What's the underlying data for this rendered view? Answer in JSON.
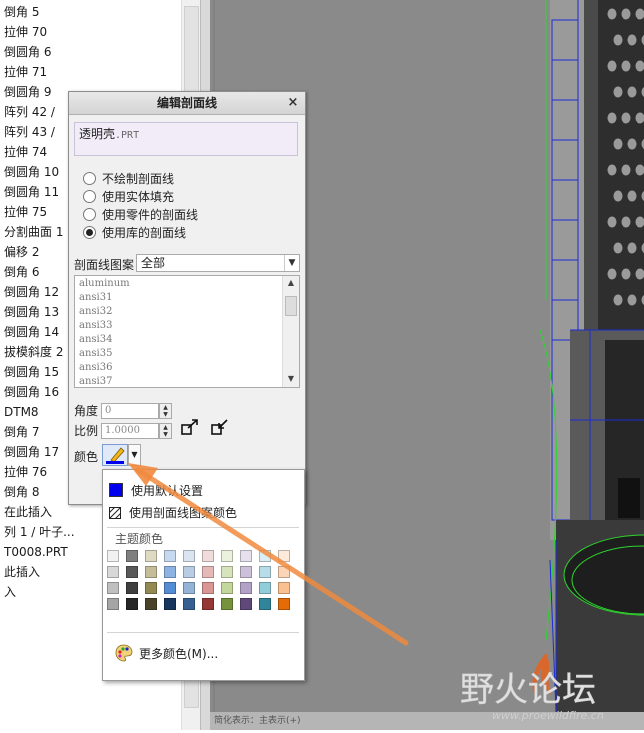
{
  "tree": {
    "items": [
      "倒角 5",
      "拉伸 70",
      "倒圆角 6",
      "拉伸 71",
      "倒圆角 9",
      "阵列 42 /",
      "阵列 43 /",
      "拉伸 74",
      "倒圆角 10",
      "倒圆角 11",
      "拉伸 75",
      "分割曲面 1",
      "偏移 2",
      "倒角 6",
      "倒圆角 12",
      "倒圆角 13",
      "倒圆角 14",
      "拔模斜度 2",
      "倒圆角 15",
      "倒圆角 16",
      "DTM8",
      "倒角 7",
      "倒圆角 17",
      "拉伸 76",
      "倒角 8",
      "在此插入",
      "列 1 / 叶子...",
      "T0008.PRT",
      "此插入",
      "入"
    ]
  },
  "dialog": {
    "title": "编辑剖面线",
    "close": "×",
    "part_name": "透明壳",
    "part_ext": ".PRT",
    "options": [
      {
        "label": "不绘制剖面线",
        "selected": false
      },
      {
        "label": "使用实体填充",
        "selected": false
      },
      {
        "label": "使用零件的剖面线",
        "selected": false
      },
      {
        "label": "使用库的剖面线",
        "selected": true
      }
    ],
    "pattern_label": "剖面线图案",
    "pattern_value": "全部",
    "pattern_list": [
      "aluminum",
      "ansi31",
      "ansi32",
      "ansi33",
      "ansi34",
      "ansi35",
      "ansi36",
      "ansi37"
    ],
    "angle_label": "角度",
    "angle_value": "0",
    "scale_label": "比例",
    "scale_value": "1.0000",
    "color_label": "颜色"
  },
  "color_menu": {
    "use_default": "使用默认设置",
    "use_pattern": "使用剖面线图案颜色",
    "theme_title": "主题颜色",
    "more": "更多颜色(M)...",
    "default_color": "#0000ee",
    "theme_rows": [
      [
        "#f2f2f2",
        "#7f7f7f",
        "#ddd9c3",
        "#c6d9f0",
        "#dbe5f1",
        "#f2dcdb",
        "#ebf1dd",
        "#e5e0ec",
        "#dbeef3",
        "#fdeada"
      ],
      [
        "#d8d8d8",
        "#595959",
        "#c4bd97",
        "#8db3e2",
        "#b8cce4",
        "#e5b9b7",
        "#d7e3bc",
        "#ccc1d9",
        "#b7dde8",
        "#fbd5b5"
      ],
      [
        "#bfbfbf",
        "#3f3f3f",
        "#938953",
        "#548dd4",
        "#95b3d7",
        "#d99694",
        "#c3d69b",
        "#b2a2c7",
        "#92cddc",
        "#fac08f"
      ],
      [
        "#a5a5a5",
        "#262626",
        "#494429",
        "#17365d",
        "#366092",
        "#953734",
        "#76923c",
        "#5f497a",
        "#31859b",
        "#e36c09"
      ]
    ]
  },
  "status": {
    "text": "简化表示：主表示(+)"
  },
  "watermark": {
    "main": "野火论坛",
    "url": "www.proewildfire.cn"
  }
}
